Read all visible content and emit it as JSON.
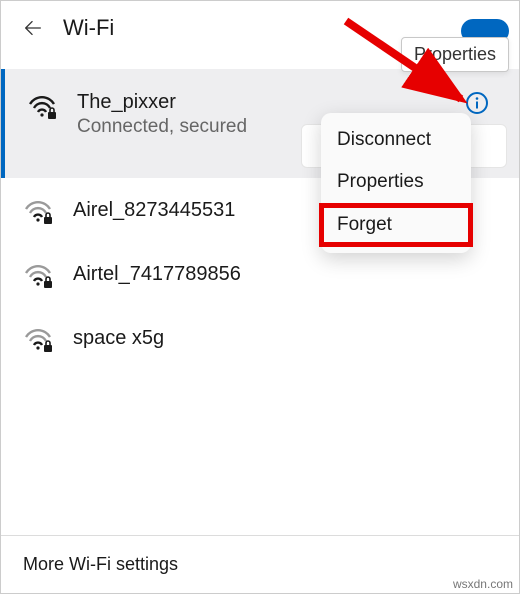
{
  "header": {
    "title": "Wi-Fi"
  },
  "tooltip": {
    "label": "Properties"
  },
  "connected": {
    "name": "The_pixxer",
    "status": "Connected, secured"
  },
  "networks": [
    {
      "name": "Airel_8273445531"
    },
    {
      "name": "Airtel_7417789856"
    },
    {
      "name": "space x5g"
    }
  ],
  "menu": {
    "disconnect": "Disconnect",
    "properties": "Properties",
    "forget": "Forget"
  },
  "footer": {
    "more": "More Wi-Fi settings"
  },
  "watermark": "wsxdn.com",
  "colors": {
    "accent": "#0067c0",
    "highlight": "#e60000"
  }
}
